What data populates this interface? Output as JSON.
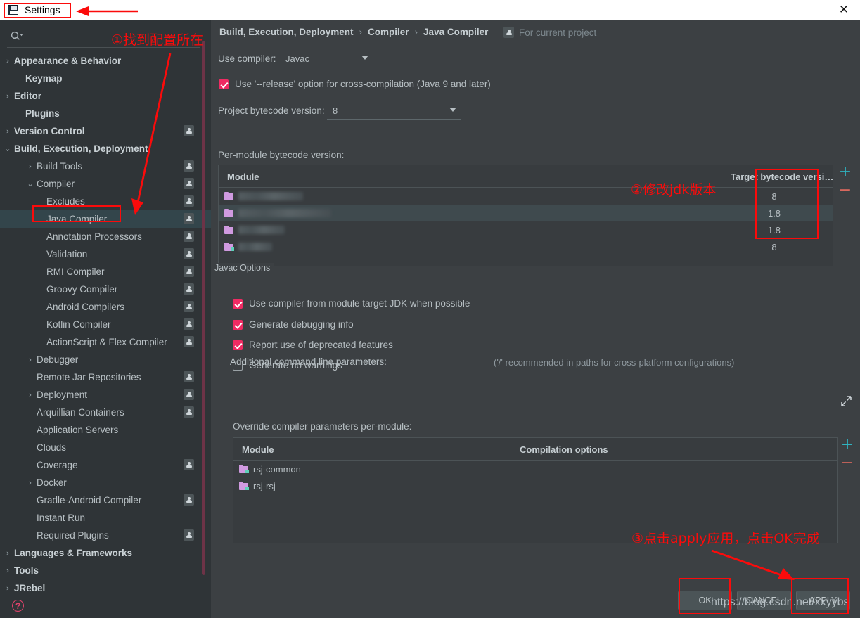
{
  "window": {
    "title": "Settings",
    "close_label": "✕",
    "app_icon": "settings-save-icon"
  },
  "sidebar": {
    "search": {
      "value": "",
      "placeholder": ""
    },
    "items": [
      {
        "label": "Appearance & Behavior",
        "indent": 20,
        "chevron": "›",
        "bold": true,
        "badge": false,
        "selected": false
      },
      {
        "label": "Keymap",
        "indent": 36,
        "chevron": "",
        "bold": true,
        "badge": false,
        "selected": false
      },
      {
        "label": "Editor",
        "indent": 20,
        "chevron": "›",
        "bold": true,
        "badge": false,
        "selected": false
      },
      {
        "label": "Plugins",
        "indent": 36,
        "chevron": "",
        "bold": true,
        "badge": false,
        "selected": false
      },
      {
        "label": "Version Control",
        "indent": 20,
        "chevron": "›",
        "bold": true,
        "badge": true,
        "selected": false
      },
      {
        "label": "Build, Execution, Deployment",
        "indent": 20,
        "chevron": "⌄",
        "bold": true,
        "badge": false,
        "selected": false
      },
      {
        "label": "Build Tools",
        "indent": 52,
        "chevron": "›",
        "bold": false,
        "badge": true,
        "selected": false
      },
      {
        "label": "Compiler",
        "indent": 52,
        "chevron": "⌄",
        "bold": false,
        "badge": true,
        "selected": false
      },
      {
        "label": "Excludes",
        "indent": 66,
        "chevron": "",
        "bold": false,
        "badge": true,
        "selected": false
      },
      {
        "label": "Java Compiler",
        "indent": 66,
        "chevron": "",
        "bold": false,
        "badge": true,
        "selected": true
      },
      {
        "label": "Annotation Processors",
        "indent": 66,
        "chevron": "",
        "bold": false,
        "badge": true,
        "selected": false
      },
      {
        "label": "Validation",
        "indent": 66,
        "chevron": "",
        "bold": false,
        "badge": true,
        "selected": false
      },
      {
        "label": "RMI Compiler",
        "indent": 66,
        "chevron": "",
        "bold": false,
        "badge": true,
        "selected": false
      },
      {
        "label": "Groovy Compiler",
        "indent": 66,
        "chevron": "",
        "bold": false,
        "badge": true,
        "selected": false
      },
      {
        "label": "Android Compilers",
        "indent": 66,
        "chevron": "",
        "bold": false,
        "badge": true,
        "selected": false
      },
      {
        "label": "Kotlin Compiler",
        "indent": 66,
        "chevron": "",
        "bold": false,
        "badge": true,
        "selected": false
      },
      {
        "label": "ActionScript & Flex Compiler",
        "indent": 66,
        "chevron": "",
        "bold": false,
        "badge": true,
        "selected": false
      },
      {
        "label": "Debugger",
        "indent": 52,
        "chevron": "›",
        "bold": false,
        "badge": false,
        "selected": false
      },
      {
        "label": "Remote Jar Repositories",
        "indent": 52,
        "chevron": "",
        "bold": false,
        "badge": true,
        "selected": false
      },
      {
        "label": "Deployment",
        "indent": 52,
        "chevron": "›",
        "bold": false,
        "badge": true,
        "selected": false
      },
      {
        "label": "Arquillian Containers",
        "indent": 52,
        "chevron": "",
        "bold": false,
        "badge": true,
        "selected": false
      },
      {
        "label": "Application Servers",
        "indent": 52,
        "chevron": "",
        "bold": false,
        "badge": false,
        "selected": false
      },
      {
        "label": "Clouds",
        "indent": 52,
        "chevron": "",
        "bold": false,
        "badge": false,
        "selected": false
      },
      {
        "label": "Coverage",
        "indent": 52,
        "chevron": "",
        "bold": false,
        "badge": true,
        "selected": false
      },
      {
        "label": "Docker",
        "indent": 52,
        "chevron": "›",
        "bold": false,
        "badge": false,
        "selected": false
      },
      {
        "label": "Gradle-Android Compiler",
        "indent": 52,
        "chevron": "",
        "bold": false,
        "badge": true,
        "selected": false
      },
      {
        "label": "Instant Run",
        "indent": 52,
        "chevron": "",
        "bold": false,
        "badge": false,
        "selected": false
      },
      {
        "label": "Required Plugins",
        "indent": 52,
        "chevron": "",
        "bold": false,
        "badge": true,
        "selected": false
      },
      {
        "label": "Languages & Frameworks",
        "indent": 20,
        "chevron": "›",
        "bold": true,
        "badge": false,
        "selected": false
      },
      {
        "label": "Tools",
        "indent": 20,
        "chevron": "›",
        "bold": true,
        "badge": false,
        "selected": false
      },
      {
        "label": "JRebel",
        "indent": 20,
        "chevron": "›",
        "bold": true,
        "badge": false,
        "selected": false
      }
    ]
  },
  "main": {
    "breadcrumb": [
      "Build, Execution, Deployment",
      "Compiler",
      "Java Compiler"
    ],
    "breadcrumb_sep": "›",
    "scope_label": "For current project",
    "use_compiler_label": "Use compiler:",
    "use_compiler_value": "Javac",
    "release_option_label": "Use '--release' option for cross-compilation (Java 9 and later)",
    "release_option_checked": true,
    "project_bytecode_label": "Project bytecode version:",
    "project_bytecode_value": "8",
    "per_module_label": "Per-module bytecode version:",
    "module_table": {
      "columns": [
        "Module",
        "Target bytecode versi…"
      ],
      "rows": [
        {
          "module": "",
          "redacted": true,
          "width": 92,
          "target": "8",
          "highlight": false,
          "dot": false
        },
        {
          "module": "",
          "redacted": true,
          "width": 132,
          "target": "1.8",
          "highlight": true,
          "dot": false
        },
        {
          "module": "",
          "redacted": true,
          "width": 66,
          "target": "1.8",
          "highlight": false,
          "dot": false
        },
        {
          "module": "",
          "redacted": true,
          "width": 48,
          "target": "8",
          "highlight": false,
          "dot": true
        }
      ],
      "add_label": "+",
      "remove_label": "−"
    },
    "javac_options": {
      "group_title": "Javac Options",
      "checkboxes": [
        {
          "label": "Use compiler from module target JDK when possible",
          "checked": true
        },
        {
          "label": "Generate debugging info",
          "checked": true
        },
        {
          "label": "Report use of deprecated features",
          "checked": true
        },
        {
          "label": "Generate no warnings",
          "checked": false
        }
      ],
      "additional_params_label": "Additional command line parameters:",
      "additional_params_value": "",
      "additional_params_hint": "('/' recommended in paths for cross-platform configurations)",
      "expand_icon": "expand-editor-icon"
    },
    "override_section": {
      "label": "Override compiler parameters per-module:",
      "columns": [
        "Module",
        "Compilation options"
      ],
      "rows": [
        {
          "module": "rsj-common",
          "options": ""
        },
        {
          "module": "rsj-rsj",
          "options": ""
        }
      ],
      "add_label": "+",
      "remove_label": "−"
    }
  },
  "footer": {
    "help_label": "?",
    "buttons": [
      {
        "label": "OK",
        "name": "ok-button"
      },
      {
        "label": "CANCEL",
        "name": "cancel-button"
      },
      {
        "label": "APPLY",
        "name": "apply-button"
      }
    ]
  },
  "annotations": {
    "step1": "①找到配置所在",
    "step2": "②修改jdk版本",
    "step3": "③点击apply应用，点击OK完成",
    "watermark": "https://blog.csdn.net/xxyybs",
    "color": "#fb0b0b"
  }
}
